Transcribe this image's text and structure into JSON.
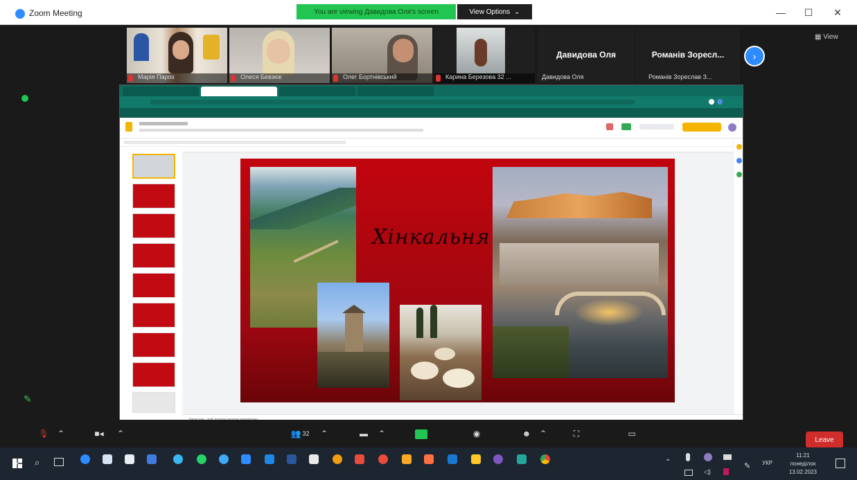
{
  "window": {
    "title": "Zoom Meeting",
    "viewing_banner": "You are viewing Давидова Оля's screen",
    "view_options": "View Options",
    "minimize": "—",
    "maximize": "☐",
    "close": "✕"
  },
  "participants": [
    {
      "name": "Марія Парох"
    },
    {
      "name": "Олеся Бевзюк"
    },
    {
      "name": "Олег Бортнівський"
    },
    {
      "name": "Карина Березова 32 ..."
    }
  ],
  "name_tiles": [
    {
      "display": "Давидова Оля",
      "label": "Давидова Оля"
    },
    {
      "display": "Романів Зоресл...",
      "label": "Романів Зореслав З..."
    }
  ],
  "top_right": {
    "view_label": "View"
  },
  "slide": {
    "title": "Хінкальня"
  },
  "notes_placeholder": "Натисніть, щоб додати нотатки доповідача",
  "controls": {
    "participants_count": "32",
    "leave": "Leave"
  },
  "taskbar": {
    "lang": "УКР",
    "time": "11:21",
    "day": "понеділок",
    "date": "13.02.2023"
  },
  "colors": {
    "zoom_blue": "#2d8cff",
    "banner_green": "#23c552",
    "slide_red": "#c1050e",
    "leave_red": "#d12d2d"
  }
}
